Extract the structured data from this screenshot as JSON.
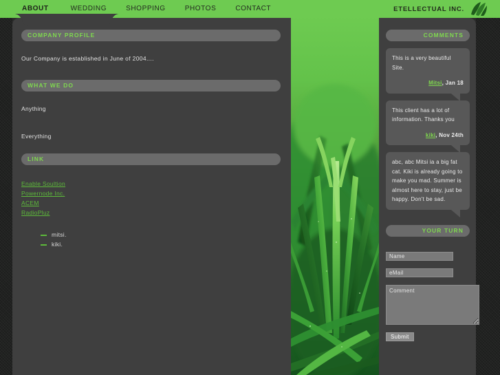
{
  "header": {
    "nav": [
      {
        "label": "ABOUT",
        "active": true
      },
      {
        "label": "WEDDING",
        "active": false
      },
      {
        "label": "SHOPPING",
        "active": false
      },
      {
        "label": "PHOTOS",
        "active": false
      },
      {
        "label": "CONTACT",
        "active": false
      }
    ],
    "brand": "ETELLECTUAL INC.",
    "logo_icon": "leaf-icon"
  },
  "main": {
    "sections": {
      "company_profile_title": "COMPANY PROFILE",
      "company_profile_text": "Our Company is established in June of 2004....",
      "what_we_do_title": "WHAT WE DO",
      "what_we_do_items": [
        "Anything",
        "Everything"
      ],
      "link_title": "LINK"
    },
    "links": [
      "Enable Soultion",
      "Powernode Inc.",
      "ACEM",
      "RadioPluz"
    ],
    "dash_items": [
      "mitsi.",
      "kiki."
    ]
  },
  "photo": {
    "alt": "close-up photograph of green grass blades"
  },
  "comments": {
    "title": "COMMENTS",
    "items": [
      {
        "text": "This is a very beautiful Site.",
        "author": "Mitsi",
        "date": ", Jan 18"
      },
      {
        "text": "This client has a lot of information. Thanks you",
        "author": "kiki",
        "date": ", Nov 24th"
      },
      {
        "text": "abc, abc Mitsi ia a big fat cat. Kiki is already going to make you mad. Summer is almost here to stay, just be happy. Don't be sad.",
        "author": "",
        "date": ""
      }
    ]
  },
  "form": {
    "title": "YOUR TURN",
    "name_placeholder": "Name",
    "name_value": "",
    "email_placeholder": "eMail",
    "email_value": "",
    "comment_placeholder": "Comment",
    "comment_value": "",
    "submit_label": "Submit"
  },
  "colors": {
    "accent_green": "#6ecb51",
    "link_green": "#5dbb3a",
    "heading_green": "#7fd84f",
    "panel_gray": "#3f3f3f",
    "bar_gray": "#6b6b6b",
    "bubble_gray": "#585858"
  }
}
